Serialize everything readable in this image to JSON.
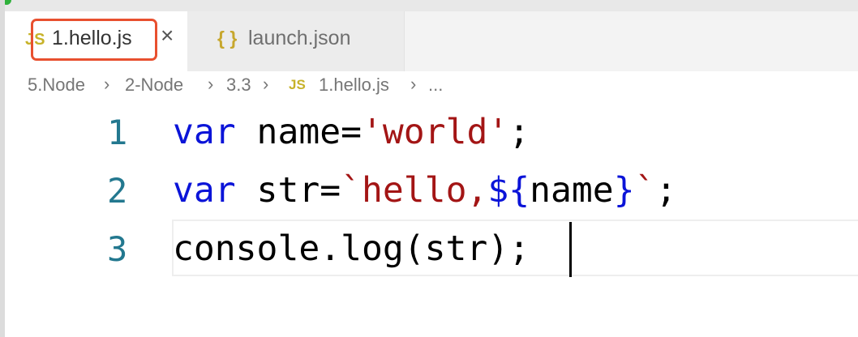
{
  "tabs": [
    {
      "label": "1.hello.js",
      "icon": "js-file-icon",
      "active": true
    },
    {
      "label": "launch.json",
      "icon": "json-braces-icon",
      "active": false
    }
  ],
  "icons": {
    "js": "JS",
    "json": "{ }",
    "close": "×"
  },
  "breadcrumb": {
    "items": [
      "5.Node",
      "2-Node",
      "3.3",
      "1.hello.js",
      "..."
    ],
    "separator": "›"
  },
  "editor": {
    "line_numbers": [
      "1",
      "2",
      "3"
    ],
    "lines": [
      {
        "t0": "var",
        "t1": " name=",
        "t2": "'world'",
        "t3": ";"
      },
      {
        "t0": "var",
        "t1": " str=",
        "t2": "`hello,",
        "t3": "${",
        "t4": "name",
        "t5": "}",
        "t6": "`",
        "t7": ";"
      },
      {
        "t0": "console.log(str);"
      }
    ]
  },
  "colors": {
    "keyword": "#0b14d8",
    "string": "#a31515",
    "line_number": "#23788f",
    "tab_highlight": "#e8502f",
    "js_icon": "#c7b229"
  }
}
